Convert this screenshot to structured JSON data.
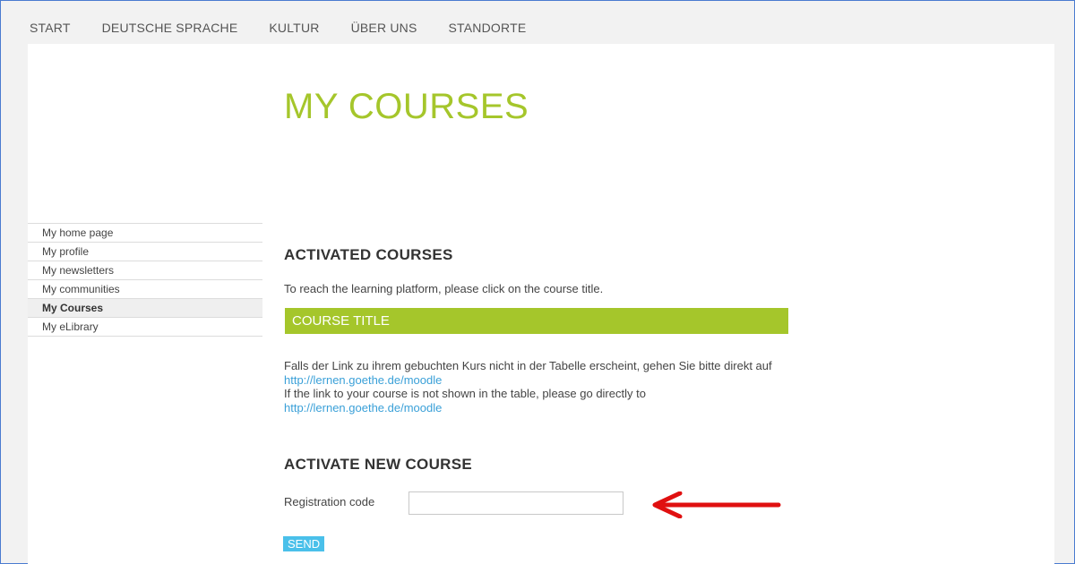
{
  "nav": {
    "items": [
      "START",
      "DEUTSCHE SPRACHE",
      "KULTUR",
      "ÜBER UNS",
      "STANDORTE"
    ]
  },
  "page": {
    "title": "MY COURSES"
  },
  "sidebar": {
    "items": [
      {
        "label": "My home page"
      },
      {
        "label": "My profile"
      },
      {
        "label": "My newsletters"
      },
      {
        "label": "My communities"
      },
      {
        "label": "My Courses",
        "active": true
      },
      {
        "label": "My eLibrary"
      }
    ]
  },
  "activated": {
    "heading": "ACTIVATED COURSES",
    "intro": "To reach the learning platform, please click on the course title.",
    "table_header": "COURSE TITLE",
    "note_de": "Falls der Link zu ihrem gebuchten Kurs nicht in der Tabelle erscheint, gehen Sie bitte direkt auf",
    "link_de": "http://lernen.goethe.de/moodle",
    "note_en": "If the link to your course is not shown in the table, please go directly to",
    "link_en": "http://lernen.goethe.de/moodle"
  },
  "activate_new": {
    "heading": "ACTIVATE NEW COURSE",
    "reg_label": "Registration code",
    "reg_value": "",
    "send_label": "SEND"
  },
  "colors": {
    "accent_green": "#a5c62b",
    "send_blue": "#4ac0ea",
    "link_blue": "#3aa0d8",
    "annotation_arrow": "#e01010"
  },
  "icons": {
    "annotation": "red-arrow-icon"
  }
}
